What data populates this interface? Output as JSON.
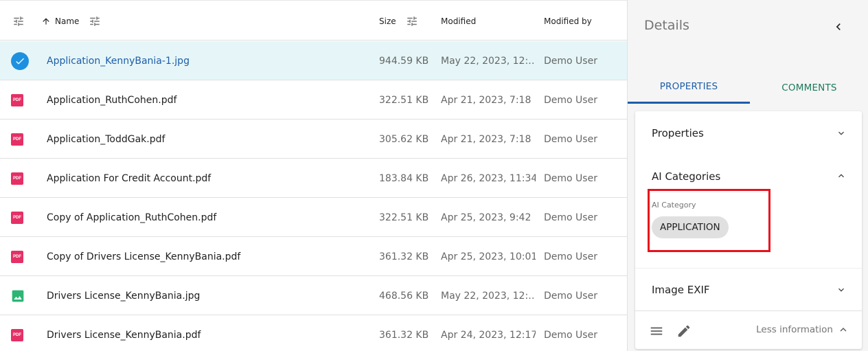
{
  "list": {
    "columns": {
      "name": "Name",
      "size": "Size",
      "modified": "Modified",
      "modified_by": "Modified by"
    },
    "rows": [
      {
        "name": "Application_KennyBania-1.jpg",
        "size": "944.59 KB",
        "modified": "May 22, 2023, 12:…",
        "modified_by": "Demo User",
        "type": "check-icon",
        "selected": true
      },
      {
        "name": "Application_RuthCohen.pdf",
        "size": "322.51 KB",
        "modified": "Apr 21, 2023, 7:18",
        "modified_by": "Demo User",
        "type": "pdf-icon"
      },
      {
        "name": "Application_ToddGak.pdf",
        "size": "305.62 KB",
        "modified": "Apr 21, 2023, 7:18",
        "modified_by": "Demo User",
        "type": "pdf-icon"
      },
      {
        "name": "Application For Credit Account.pdf",
        "size": "183.84 KB",
        "modified": "Apr 26, 2023, 11:34",
        "modified_by": "Demo User",
        "type": "pdf-icon"
      },
      {
        "name": "Copy of Application_RuthCohen.pdf",
        "size": "322.51 KB",
        "modified": "Apr 25, 2023, 9:42",
        "modified_by": "Demo User",
        "type": "pdf-icon"
      },
      {
        "name": "Copy of Drivers License_KennyBania.pdf",
        "size": "361.32 KB",
        "modified": "Apr 25, 2023, 10:01",
        "modified_by": "Demo User",
        "type": "pdf-icon"
      },
      {
        "name": "Drivers License_KennyBania.jpg",
        "size": "468.56 KB",
        "modified": "May 22, 2023, 12:…",
        "modified_by": "Demo User",
        "type": "image-icon"
      },
      {
        "name": "Drivers License_KennyBania.pdf",
        "size": "361.32 KB",
        "modified": "Apr 24, 2023, 12:17",
        "modified_by": "Demo User",
        "type": "pdf-icon"
      }
    ],
    "pdf_badge": "PDF"
  },
  "details": {
    "title": "Details",
    "tabs": [
      "PROPERTIES",
      "COMMENTS"
    ],
    "sections": {
      "properties": "Properties",
      "ai_categories": "AI Categories",
      "image_exif": "Image EXIF"
    },
    "ai_category_label": "AI Category",
    "ai_category_value": "APPLICATION",
    "less_info": "Less information"
  },
  "colors": {
    "accent": "#1d5da8",
    "pdf": "#e53066",
    "image": "#2bb673",
    "selected_row": "#e6f6f8",
    "highlight": "#e8101c"
  }
}
